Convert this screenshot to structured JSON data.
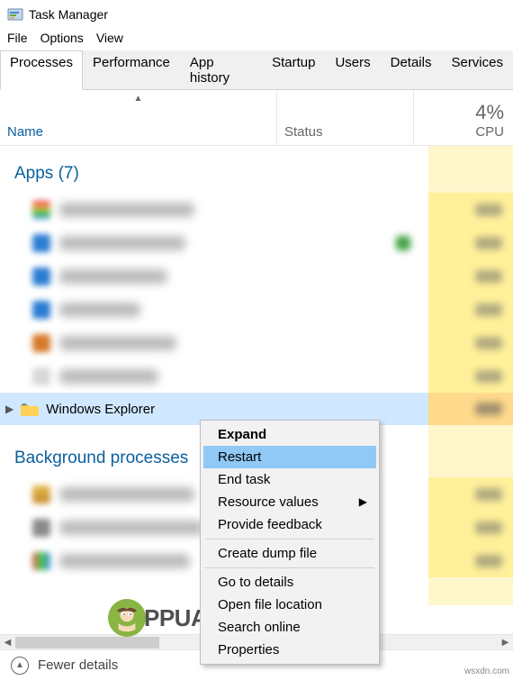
{
  "window": {
    "title": "Task Manager"
  },
  "menu": {
    "file": "File",
    "options": "Options",
    "view": "View"
  },
  "tabs": {
    "processes": "Processes",
    "performance": "Performance",
    "app_history": "App history",
    "startup": "Startup",
    "users": "Users",
    "details": "Details",
    "services": "Services"
  },
  "columns": {
    "name": "Name",
    "status": "Status",
    "cpu_label": "CPU",
    "cpu_pct": "4%"
  },
  "groups": {
    "apps": "Apps (7)",
    "bg": "Background processes"
  },
  "selected_row": {
    "name": "Windows Explorer"
  },
  "context_menu": {
    "expand": "Expand",
    "restart": "Restart",
    "end_task": "End task",
    "resource_values": "Resource values",
    "provide_feedback": "Provide feedback",
    "create_dump": "Create dump file",
    "go_to_details": "Go to details",
    "open_file_location": "Open file location",
    "search_online": "Search online",
    "properties": "Properties"
  },
  "footer": {
    "fewer_details": "Fewer details"
  },
  "watermark": {
    "text": "PPUALS",
    "domain": "wsxdn.com"
  }
}
